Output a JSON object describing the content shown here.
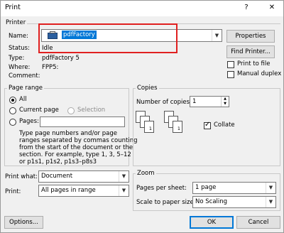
{
  "window": {
    "title": "Print",
    "help": "?",
    "close": "✕"
  },
  "printer": {
    "group_label": "Printer",
    "name_label": "Name:",
    "name_value": "pdfFactory",
    "status_label": "Status:",
    "status_value": "Idle",
    "type_label": "Type:",
    "type_value": "pdfFactory 5",
    "where_label": "Where:",
    "where_value": "FPP5:",
    "comment_label": "Comment:",
    "properties_button": "Properties",
    "find_printer_button": "Find Printer...",
    "print_to_file": "Print to file",
    "manual_duplex": "Manual duplex"
  },
  "page_range": {
    "group_label": "Page range",
    "all": "All",
    "current_page": "Current page",
    "selection": "Selection",
    "pages": "Pages:",
    "help_text_1": "Type page numbers and/or page",
    "help_text_2": "ranges separated by commas counting",
    "help_text_3": "from the start of the document or the",
    "help_text_4": "section. For example, type 1, 3, 5–12",
    "help_text_5": "or p1s1, p1s2, p1s3–p8s3",
    "selected": "all"
  },
  "copies": {
    "group_label": "Copies",
    "number_label": "Number of copies:",
    "number_value": "1",
    "collate": "Collate",
    "collate_checked": true
  },
  "print_options": {
    "print_what_label": "Print what:",
    "print_what_value": "Document",
    "print_label": "Print:",
    "print_value": "All pages in range"
  },
  "zoom": {
    "group_label": "Zoom",
    "pages_per_sheet_label": "Pages per sheet:",
    "pages_per_sheet_value": "1 page",
    "scale_label": "Scale to paper size:",
    "scale_value": "No Scaling"
  },
  "footer": {
    "options_button": "Options...",
    "ok_button": "OK",
    "cancel_button": "Cancel"
  },
  "colors": {
    "highlight": "#e02020",
    "selection": "#0078d7"
  }
}
